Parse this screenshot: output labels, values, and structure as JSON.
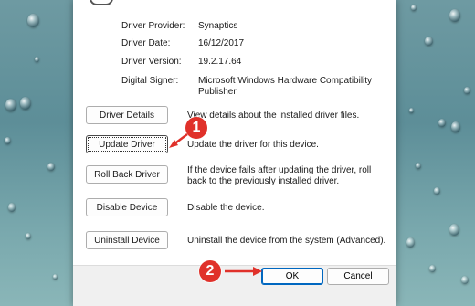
{
  "properties": [
    {
      "label": "Driver Provider:",
      "value": "Synaptics"
    },
    {
      "label": "Driver Date:",
      "value": "16/12/2017"
    },
    {
      "label": "Driver Version:",
      "value": "19.2.17.64"
    },
    {
      "label": "Digital Signer:",
      "value": "Microsoft Windows Hardware Compatibility Publisher"
    }
  ],
  "actions": [
    {
      "button": "Driver Details",
      "description": "View details about the installed driver files."
    },
    {
      "button": "Update Driver",
      "description": "Update the driver for this device."
    },
    {
      "button": "Roll Back Driver",
      "description": "If the device fails after updating the driver, roll back to the previously installed driver."
    },
    {
      "button": "Disable Device",
      "description": "Disable the device."
    },
    {
      "button": "Uninstall Device",
      "description": "Uninstall the device from the system (Advanced)."
    }
  ],
  "footer": {
    "ok": "OK",
    "cancel": "Cancel"
  },
  "annotations": {
    "step1": "1",
    "step2": "2",
    "color": "#e0312a"
  }
}
